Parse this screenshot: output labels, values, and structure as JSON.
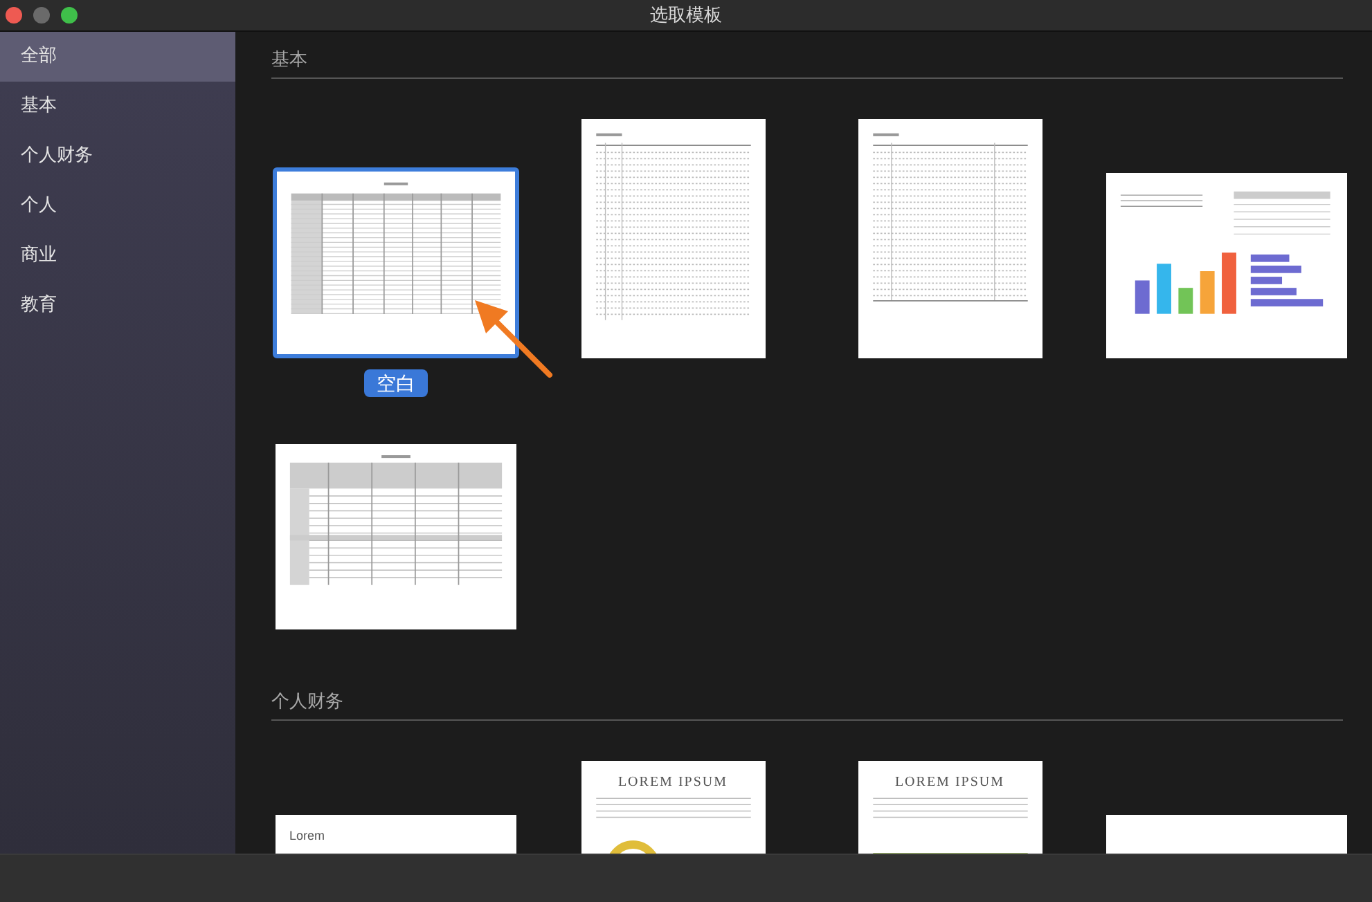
{
  "window": {
    "title": "选取模板"
  },
  "sidebar": {
    "items": [
      {
        "label": "全部",
        "selected": true
      },
      {
        "label": "基本",
        "selected": false
      },
      {
        "label": "个人财务",
        "selected": false
      },
      {
        "label": "个人",
        "selected": false
      },
      {
        "label": "商业",
        "selected": false
      },
      {
        "label": "教育",
        "selected": false
      }
    ]
  },
  "sections": [
    {
      "title": "基本",
      "templates": [
        {
          "kind": "table",
          "selected": true,
          "label": "空白"
        },
        {
          "kind": "checklist",
          "selected": false
        },
        {
          "kind": "invoice",
          "selected": false
        },
        {
          "kind": "charts",
          "selected": false
        },
        {
          "kind": "grouped",
          "selected": false
        }
      ]
    },
    {
      "title": "个人财务",
      "templates": [
        {
          "kind": "lorem",
          "selected": false,
          "heading": "Lorem"
        },
        {
          "kind": "report",
          "selected": false,
          "heading": "LOREM IPSUM"
        },
        {
          "kind": "budget",
          "selected": false,
          "heading": "LOREM IPSUM"
        },
        {
          "kind": "plain",
          "selected": false
        }
      ]
    }
  ]
}
